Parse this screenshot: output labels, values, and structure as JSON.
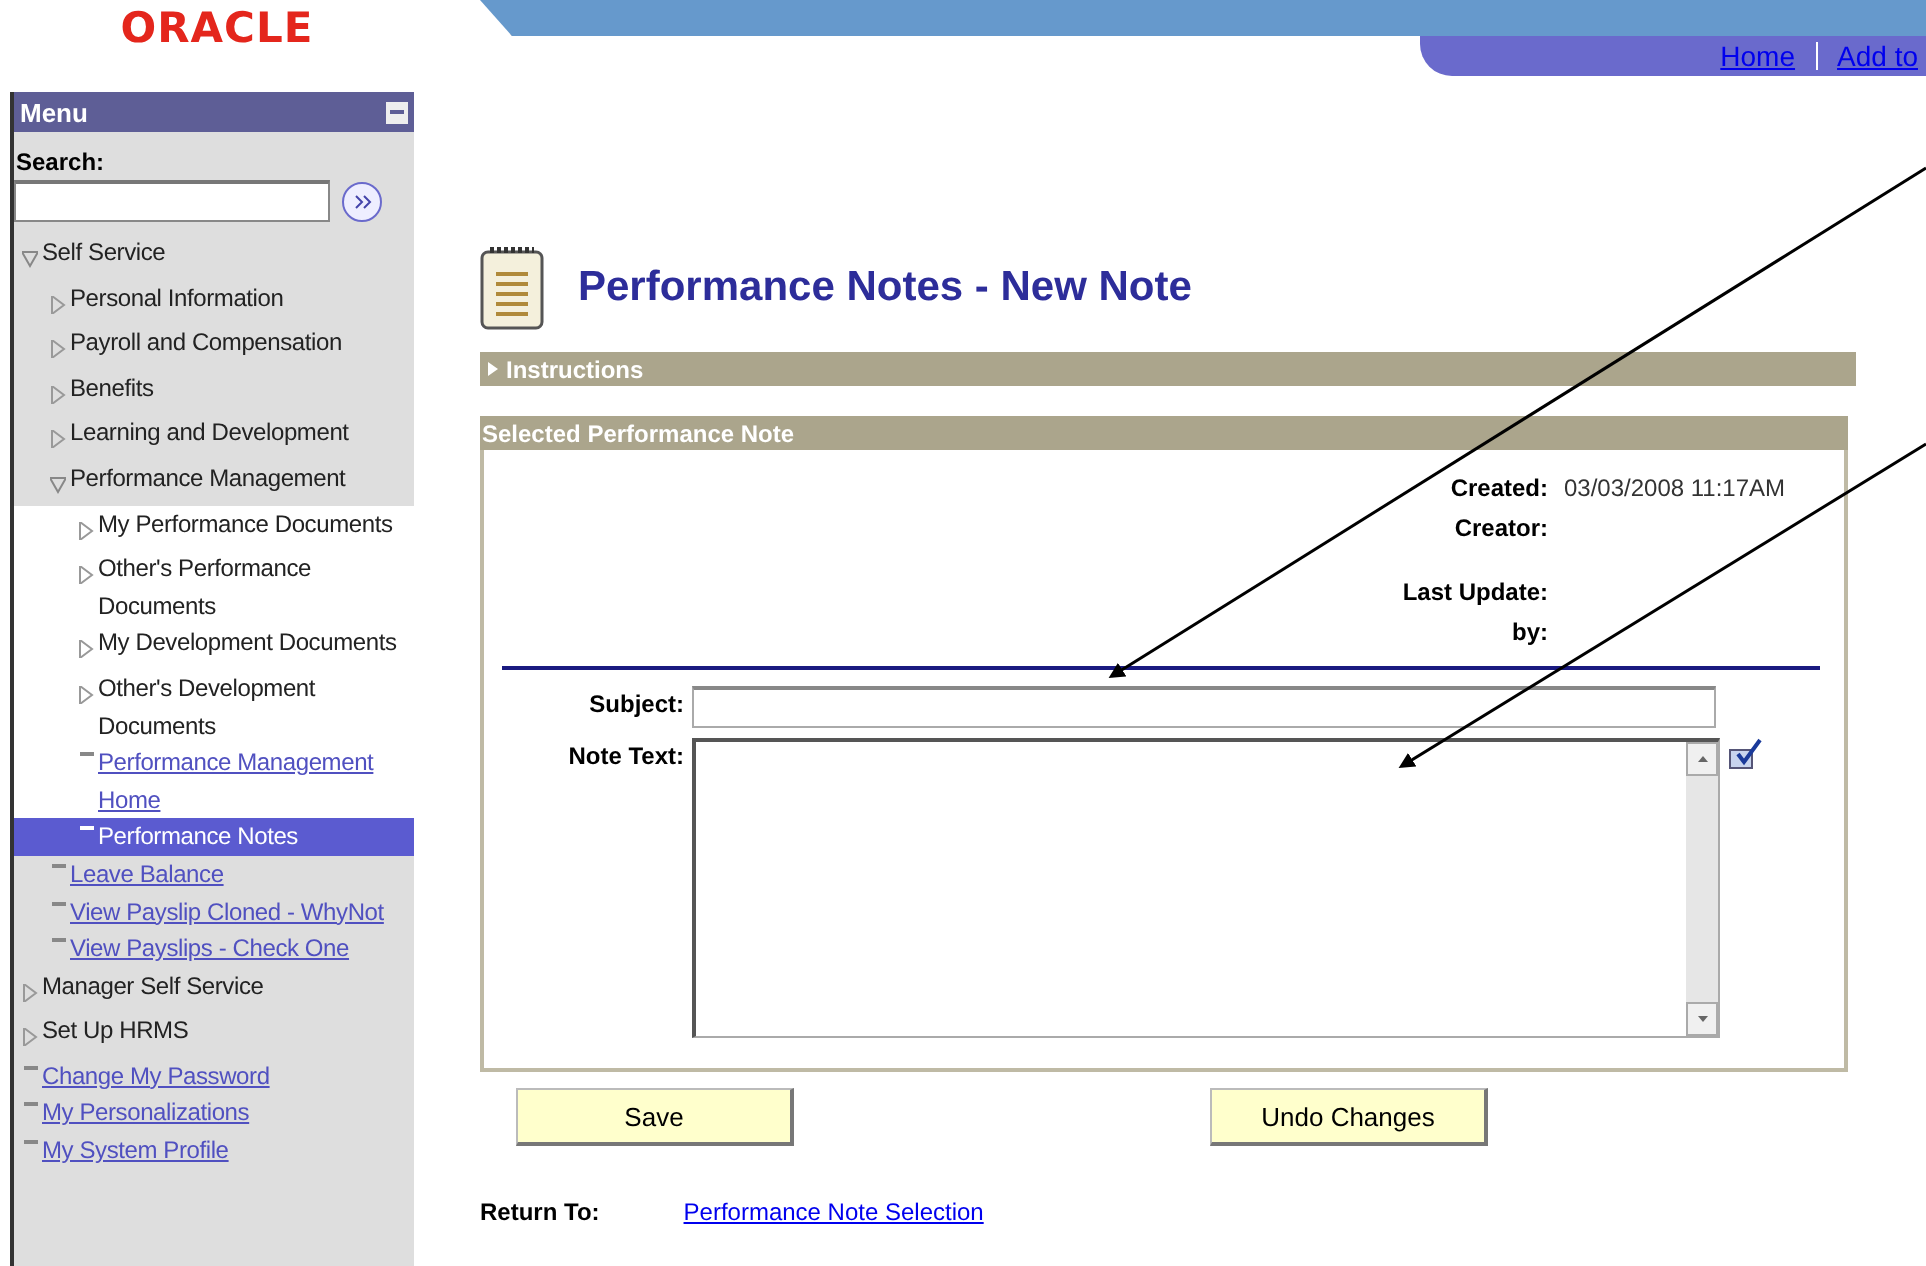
{
  "header": {
    "logo": "ORACLE",
    "nav_links": [
      "Home",
      "Add to"
    ]
  },
  "menu": {
    "title": "Menu",
    "search": {
      "label": "Search:"
    },
    "items": [
      {
        "kind": "folder",
        "label": "Self Service",
        "expanded": true,
        "selected": false,
        "children": [
          {
            "kind": "folder",
            "label": "Personal Information",
            "expanded": false,
            "selected": false
          },
          {
            "kind": "folder",
            "label": "Payroll and Compensation",
            "expanded": false,
            "selected": false
          },
          {
            "kind": "folder",
            "label": "Benefits",
            "expanded": false,
            "selected": false
          },
          {
            "kind": "folder",
            "label": "Learning and Development",
            "expanded": false,
            "selected": false
          },
          {
            "kind": "folder",
            "label": "Performance Management",
            "expanded": true,
            "selected": false,
            "children": [
              {
                "kind": "folder",
                "label": "My Performance Documents",
                "expanded": false,
                "selected": false
              },
              {
                "kind": "folder",
                "label": "Other's Performance Documents",
                "expanded": false,
                "selected": false
              },
              {
                "kind": "folder",
                "label": "My Development Documents",
                "expanded": false,
                "selected": false
              },
              {
                "kind": "folder",
                "label": "Other's Development Documents",
                "expanded": false,
                "selected": false
              },
              {
                "kind": "link",
                "label": "Performance Management Home",
                "selected": false
              },
              {
                "kind": "link",
                "label": "Performance Notes",
                "selected": true
              }
            ]
          },
          {
            "kind": "link",
            "label": "Leave Balance",
            "selected": false
          },
          {
            "kind": "link",
            "label": "View Payslip Cloned - WhyNot",
            "selected": false
          },
          {
            "kind": "link",
            "label": "View Payslips - Check One",
            "selected": false
          }
        ]
      },
      {
        "kind": "folder",
        "label": "Manager Self Service",
        "expanded": false,
        "selected": false
      },
      {
        "kind": "folder",
        "label": "Set Up HRMS",
        "expanded": false,
        "selected": false
      },
      {
        "kind": "link",
        "label": "Change My Password",
        "selected": false
      },
      {
        "kind": "link",
        "label": "My Personalizations",
        "selected": false
      },
      {
        "kind": "link",
        "label": "My System Profile",
        "selected": false
      }
    ]
  },
  "page": {
    "title": "Performance Notes - New Note",
    "instructions": {
      "label": "Instructions",
      "expanded": false
    },
    "group": {
      "title": "Selected Performance Note",
      "info_rows": [
        {
          "label": "Created:",
          "value": "03/03/2008 11:17AM"
        },
        {
          "label": "Creator:"
        },
        {
          "label": "Last Update:"
        },
        {
          "label": "by:"
        }
      ],
      "subject": {
        "label": "Subject:"
      },
      "note_text": {
        "label": "Note Text:"
      }
    },
    "buttons": [
      "Save",
      "Undo Changes"
    ],
    "return_to": {
      "label": "Return To:",
      "link": "Performance Note Selection"
    }
  }
}
